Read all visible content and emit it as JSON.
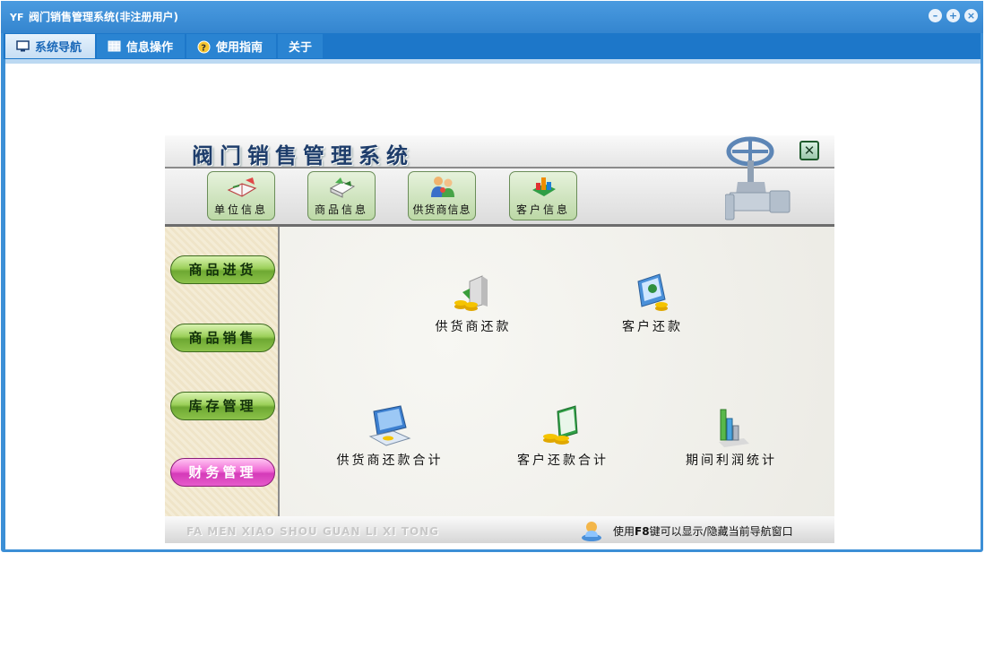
{
  "window": {
    "title": "阀门销售管理系统(非注册用户)",
    "app_icon": "yf-logo-icon",
    "controls": [
      "minimize-icon",
      "maximize-icon",
      "close-icon"
    ]
  },
  "menu": {
    "tabs": [
      {
        "label": "系统导航",
        "icon": "monitor-icon",
        "active": true
      },
      {
        "label": "信息操作",
        "icon": "grid-icon",
        "active": false
      },
      {
        "label": "使用指南",
        "icon": "help-icon",
        "active": false
      },
      {
        "label": "关于",
        "icon": "",
        "active": false
      }
    ]
  },
  "navigator": {
    "title": "阀门销售管理系统",
    "toolbar": [
      {
        "label": "单位信息",
        "icon": "book-icon"
      },
      {
        "label": "商品信息",
        "icon": "goods-icon"
      },
      {
        "label": "供货商信息",
        "icon": "people-icon"
      },
      {
        "label": "客户信息",
        "icon": "chart-icon"
      }
    ],
    "side_menu": [
      {
        "label": "商品进货",
        "active": false
      },
      {
        "label": "商品销售",
        "active": false
      },
      {
        "label": "库存管理",
        "active": false
      },
      {
        "label": "财务管理",
        "active": true
      }
    ],
    "functions": [
      {
        "label": "供货商还款",
        "icon": "supplier-repay-icon"
      },
      {
        "label": "客户还款",
        "icon": "customer-repay-icon"
      },
      {
        "label": "供货商还款合计",
        "icon": "supplier-repay-total-icon"
      },
      {
        "label": "客户还款合计",
        "icon": "customer-repay-total-icon"
      },
      {
        "label": "期间利润统计",
        "icon": "profit-stats-icon"
      }
    ],
    "footer_left": "FA MEN XIAO SHOU GUAN LI XI TONG",
    "footer_hint_prefix": "使用",
    "footer_hint_key": "F8",
    "footer_hint_suffix": "键可以显示/隐藏当前导航窗口",
    "close_glyph": "✕"
  },
  "colors": {
    "titlebar": "#3c8fd6",
    "menubar": "#1d77c9",
    "side_active": "#e65bcb",
    "side_normal": "#8cc24a"
  }
}
